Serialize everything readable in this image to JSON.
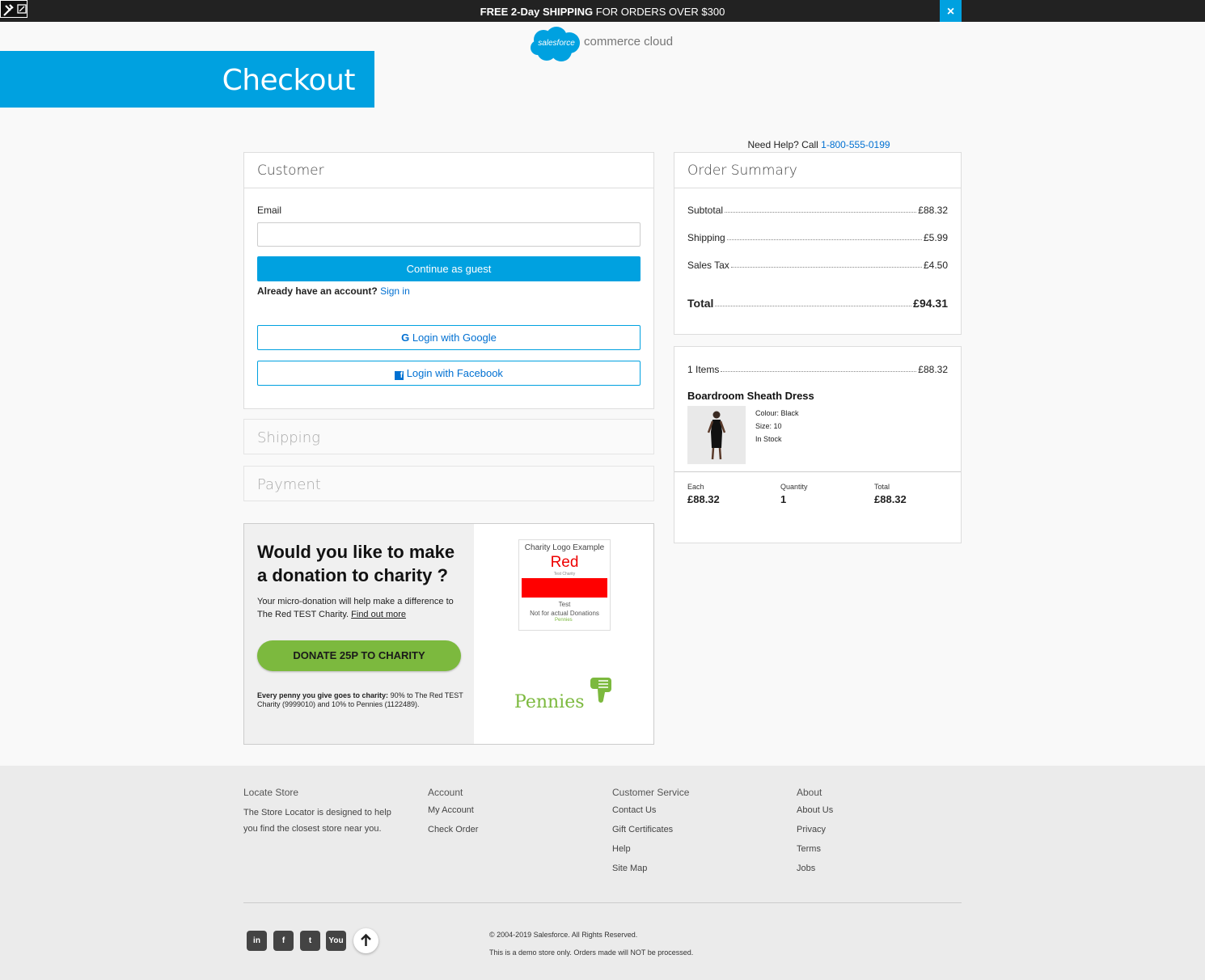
{
  "promo": {
    "bold": "FREE 2-Day SHIPPING",
    "rest": " FOR ORDERS OVER $300",
    "close": "×"
  },
  "logo": {
    "brand": "salesforce",
    "text": "commerce cloud"
  },
  "banner": {
    "title": "Checkout"
  },
  "help": {
    "prefix": "Need Help? Call ",
    "phone": "1-800-555-0199"
  },
  "customer": {
    "title": "Customer",
    "email_label": "Email",
    "email_value": "",
    "guest_button": "Continue as guest",
    "already": "Already have an account?",
    "signin": "Sign in",
    "google": "Login with Google",
    "facebook": "Login with Facebook"
  },
  "shipping": {
    "title": "Shipping"
  },
  "payment": {
    "title": "Payment"
  },
  "charity": {
    "title": "Would you like to make a donation to charity ?",
    "desc": "Your micro-donation will help make a difference to The Red TEST Charity. ",
    "link": "Find out more",
    "button": "DONATE 25P TO CHARITY",
    "note_bold": "Every penny you give goes to charity:",
    "note": " 90% to The Red TEST Charity (9999010) and 10% to Pennies (1122489).",
    "logo_line1": "Charity Logo Example",
    "logo_red": "Red",
    "logo_small": "Test Charity",
    "logo_test": "Test",
    "logo_not": "Not for actual Donations",
    "logo_pennies": "Pennies",
    "pennies": "Pennies"
  },
  "summary": {
    "title": "Order Summary",
    "subtotal_label": "Subtotal",
    "subtotal": "£88.32",
    "shipping_label": "Shipping",
    "shipping": "£5.99",
    "tax_label": "Sales Tax",
    "tax": "£4.50",
    "total_label": "Total",
    "total": "£94.31"
  },
  "items": {
    "count_label": "1 Items",
    "count_total": "£88.32",
    "product": "Boardroom Sheath Dress",
    "colour": "Colour: Black",
    "size": "Size: 10",
    "stock": "In Stock",
    "each_label": "Each",
    "each": "£88.32",
    "qty_label": "Quantity",
    "qty": "1",
    "total_label": "Total",
    "total": "£88.32"
  },
  "footer": {
    "locate": {
      "title": "Locate Store",
      "text": "The Store Locator is designed to help you find the closest store near you."
    },
    "account": {
      "title": "Account",
      "links": [
        "My Account",
        "Check Order"
      ]
    },
    "service": {
      "title": "Customer Service",
      "links": [
        "Contact Us",
        "Gift Certificates",
        "Help",
        "Site Map"
      ]
    },
    "about": {
      "title": "About",
      "links": [
        "About Us",
        "Privacy",
        "Terms",
        "Jobs"
      ]
    },
    "social": {
      "linkedin": "in",
      "facebook": "f",
      "twitter": "t",
      "youtube": "You"
    },
    "copyright": "© 2004-2019 Salesforce. All Rights Reserved.",
    "demo": "This is a demo store only. Orders made will NOT be processed."
  },
  "colors": {
    "accent": "#00a1e0",
    "link": "#0070d2",
    "donate": "#7cb93e"
  }
}
